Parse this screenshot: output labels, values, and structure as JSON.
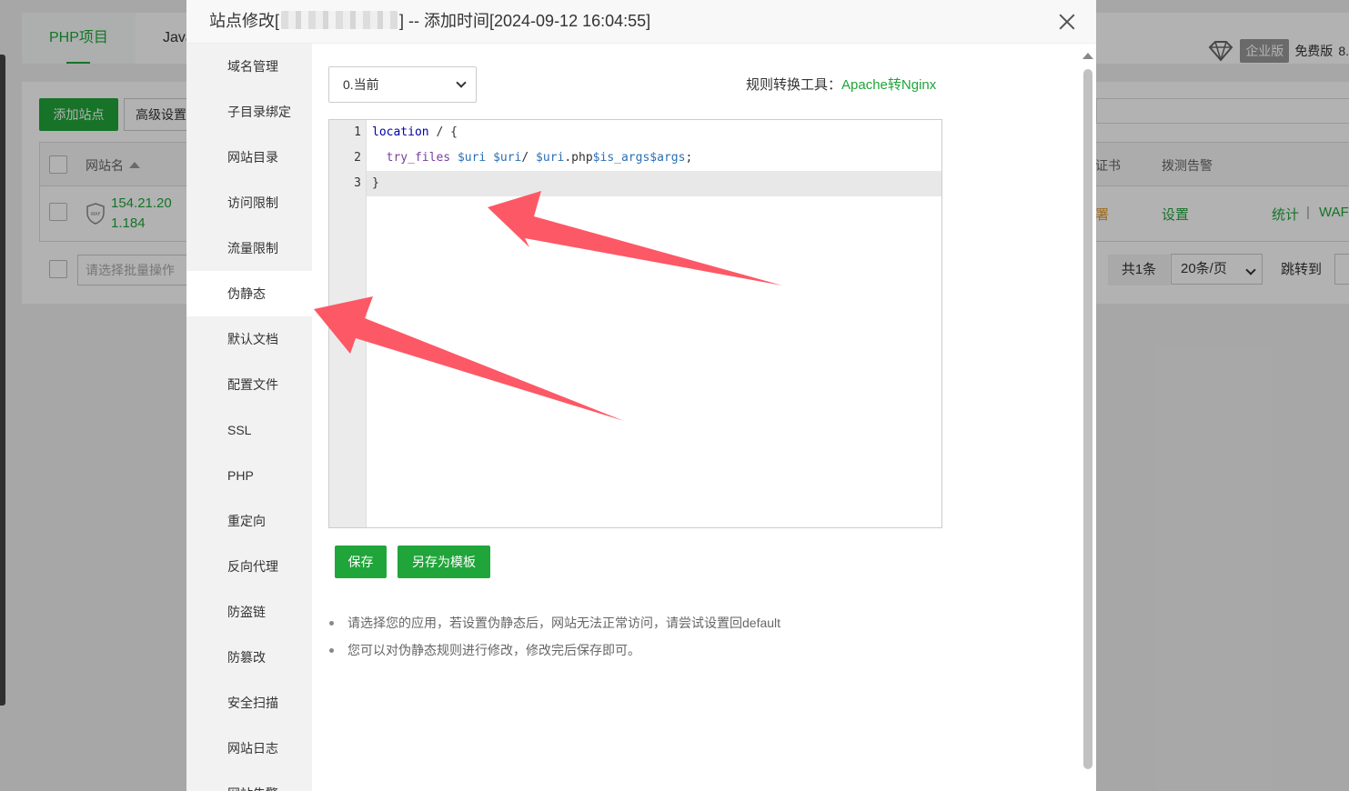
{
  "background": {
    "tabs": [
      "PHP项目",
      "Java"
    ],
    "header": {
      "edition_badge": "企业版",
      "free_label": "免费版",
      "version_prefix": "8."
    },
    "toolbar": {
      "add_site": "添加站点",
      "advanced": "高级设置"
    },
    "table": {
      "col_sitename": "网站名",
      "col_cert": "证书",
      "col_probe": "拨测告警",
      "row": {
        "site": "154.21.20\n1.184",
        "deploy_fragment": "署",
        "settings": "设置",
        "stats": "统计",
        "sep": "|",
        "waf": "WAF"
      }
    },
    "footer": {
      "batch_placeholder": "请选择批量操作",
      "total": "共1条",
      "page_size": "20条/页",
      "jump": "跳转到"
    }
  },
  "dialog": {
    "title_prefix": "站点修改[",
    "title_suffix": "] -- 添加时间[2024-09-12 16:04:55]",
    "nav": [
      "域名管理",
      "子目录绑定",
      "网站目录",
      "访问限制",
      "流量限制",
      "伪静态",
      "默认文档",
      "配置文件",
      "SSL",
      "PHP",
      "重定向",
      "反向代理",
      "防盗链",
      "防篡改",
      "安全扫描",
      "网站日志",
      "网站告警"
    ],
    "active_nav": "伪静态",
    "version_select": "0.当前",
    "convert_tool_label": "规则转换工具：",
    "convert_tool_link": "Apache转Nginx",
    "editor": {
      "line_numbers": [
        "1",
        "2",
        "3"
      ],
      "lines": [
        "location / {",
        "  try_files $uri $uri/ $uri.php$is_args$args;",
        "}"
      ]
    },
    "buttons": {
      "save": "保存",
      "save_template": "另存为模板"
    },
    "tips": [
      "请选择您的应用，若设置伪静态后，网站无法正常访问，请尝试设置回default",
      "您可以对伪静态规则进行修改，修改完后保存即可。"
    ]
  },
  "colors": {
    "accent": "#20a53a",
    "arrow": "#fd5865",
    "overlay": "rgba(0,0,0,0.3)"
  }
}
